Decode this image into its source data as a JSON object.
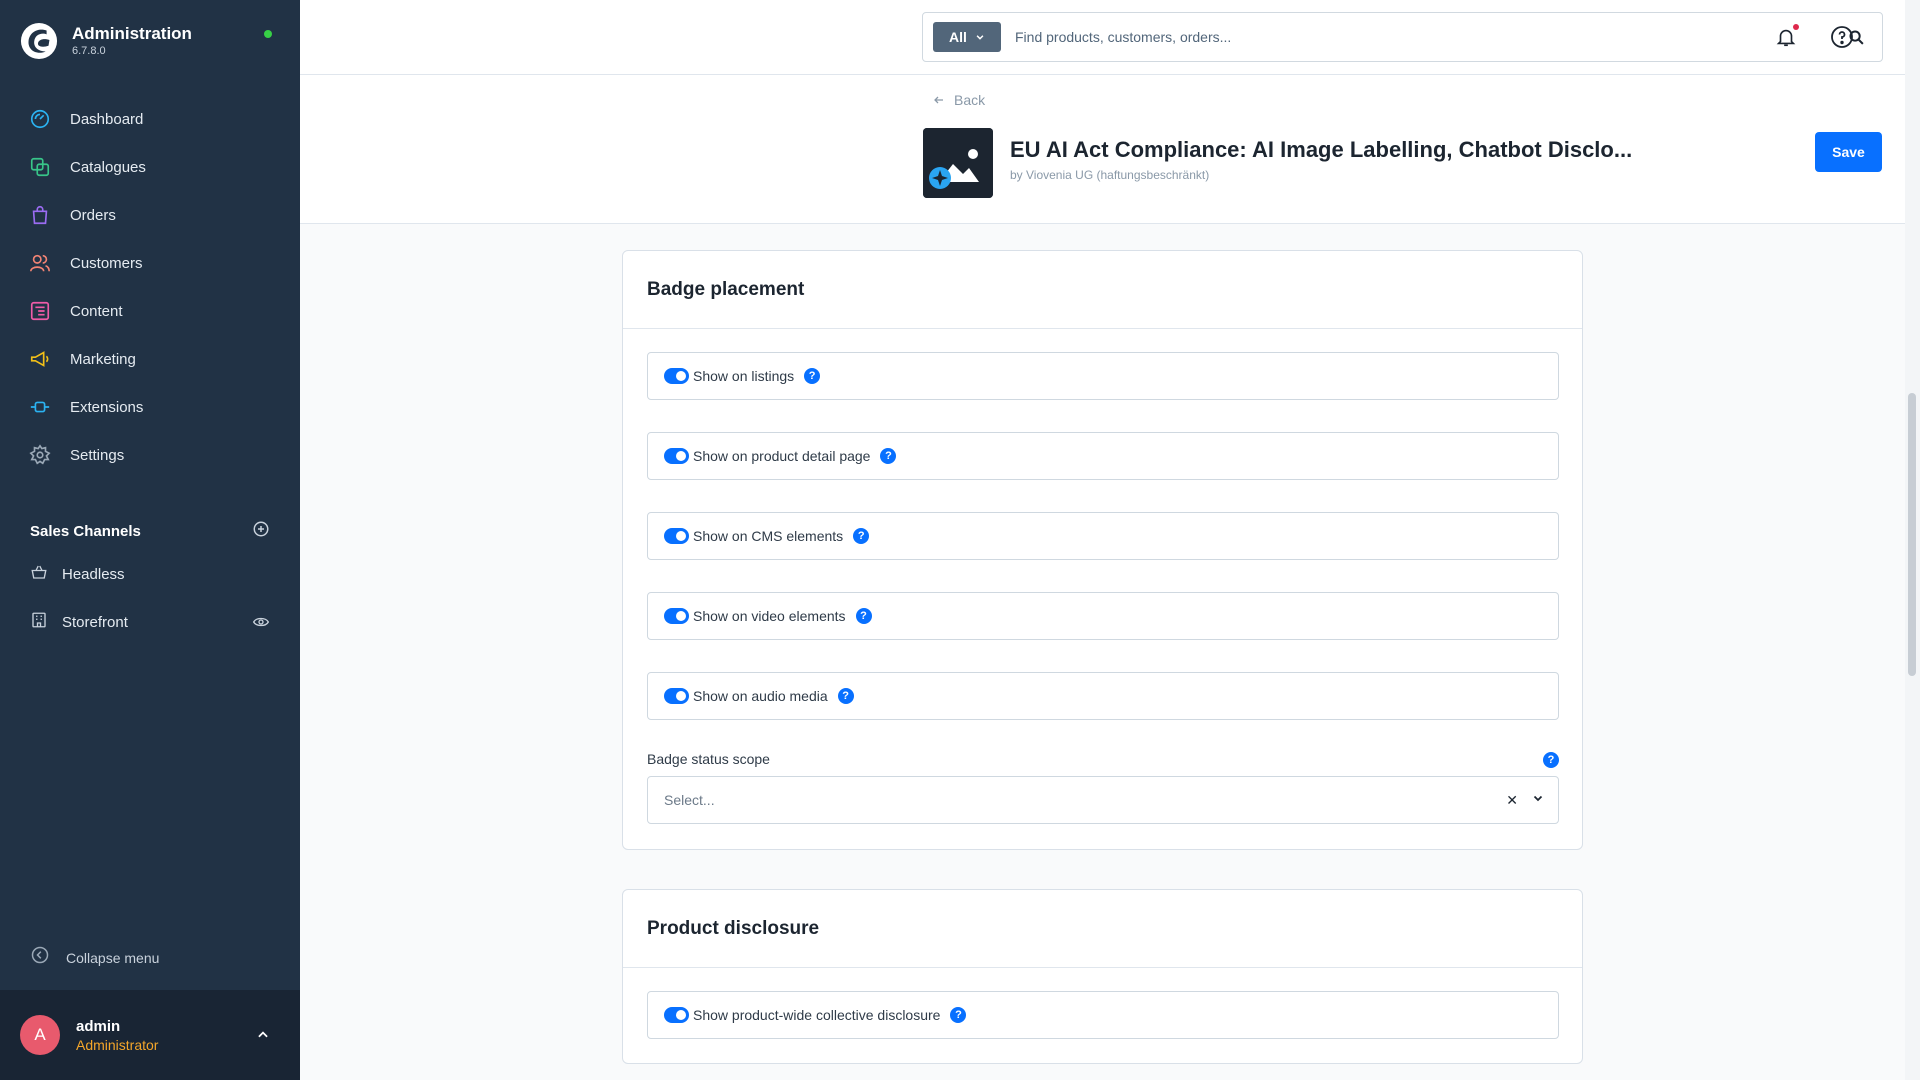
{
  "brand": {
    "title": "Administration",
    "version": "6.7.8.0"
  },
  "nav": [
    {
      "label": "Dashboard",
      "icon": "dashboard-icon"
    },
    {
      "label": "Catalogues",
      "icon": "catalogue-icon"
    },
    {
      "label": "Orders",
      "icon": "shopping-bag-icon"
    },
    {
      "label": "Customers",
      "icon": "users-icon"
    },
    {
      "label": "Content",
      "icon": "content-icon"
    },
    {
      "label": "Marketing",
      "icon": "megaphone-icon"
    },
    {
      "label": "Extensions",
      "icon": "plug-icon"
    },
    {
      "label": "Settings",
      "icon": "gear-icon"
    }
  ],
  "sales_channels": {
    "title": "Sales Channels",
    "items": [
      {
        "label": "Headless"
      },
      {
        "label": "Storefront"
      }
    ]
  },
  "collapse_label": "Collapse menu",
  "user": {
    "initial": "A",
    "name": "admin",
    "role": "Administrator"
  },
  "search": {
    "type_label": "All",
    "placeholder": "Find products, customers, orders..."
  },
  "smartbar": {
    "back_label": "Back",
    "title": "EU AI Act Compliance: AI Image Labelling, Chatbot Disclo...",
    "vendor": "by Viovenia UG (haftungsbeschränkt)",
    "save_label": "Save"
  },
  "badge_card": {
    "title": "Badge placement",
    "toggles": [
      {
        "label": "Show on listings",
        "enabled": true
      },
      {
        "label": "Show on product detail page",
        "enabled": true
      },
      {
        "label": "Show on CMS elements",
        "enabled": true
      },
      {
        "label": "Show on video elements",
        "enabled": true
      },
      {
        "label": "Show on audio media",
        "enabled": true
      }
    ],
    "scope_label": "Badge status scope",
    "scope_placeholder": "Select..."
  },
  "disclosure_card": {
    "title": "Product disclosure",
    "toggles": [
      {
        "label": "Show product-wide collective disclosure",
        "enabled": true
      }
    ]
  },
  "colors": {
    "sidebar": "#213245",
    "accent": "#0870ff",
    "role": "#f4a62a",
    "avatar": "#e85a6d"
  }
}
